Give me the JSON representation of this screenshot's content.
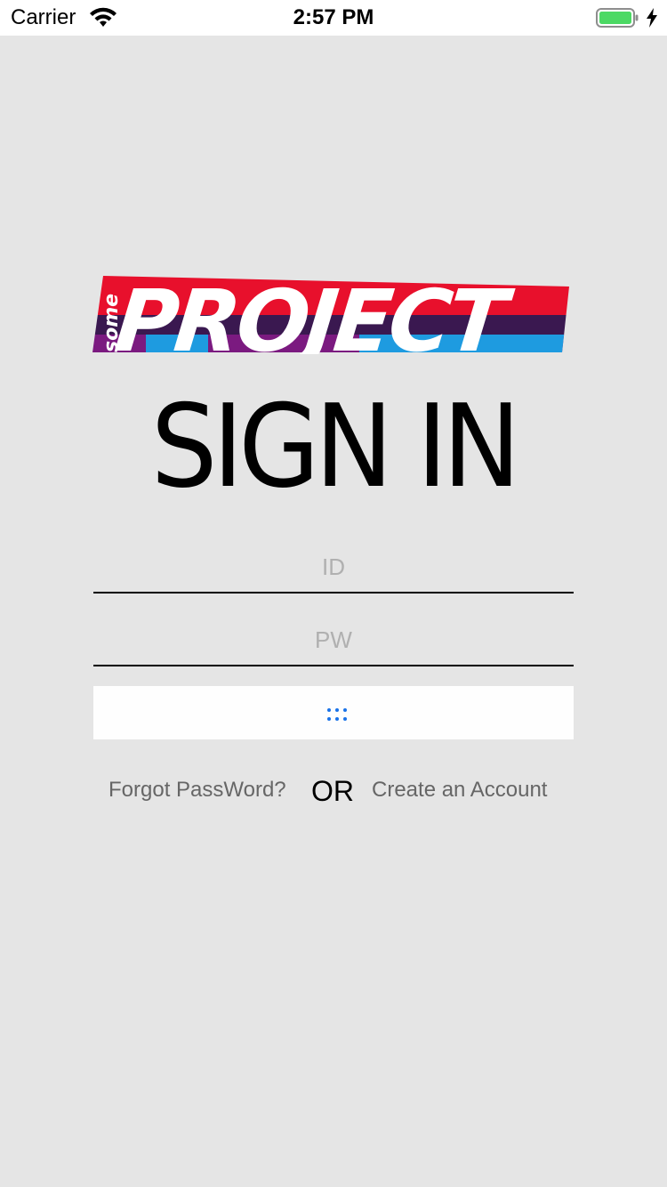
{
  "status_bar": {
    "carrier": "Carrier",
    "time": "2:57 PM",
    "battery_color": "#4cd964",
    "wifi_icon": "wifi-icon",
    "battery_icon": "battery-icon",
    "charging_icon": "charging-bolt-icon"
  },
  "logo": {
    "small_text": "some",
    "main_text": "PROJECT",
    "colors": {
      "red": "#e8102c",
      "dark": "#3a1850",
      "purple": "#7b1a80",
      "blue": "#1e9be0"
    }
  },
  "signin": {
    "title": "SIGN IN",
    "id_placeholder": "ID",
    "pw_placeholder": "PW",
    "submit_icon": "dots-grid-icon",
    "submit_icon_color": "#1a73e8"
  },
  "links": {
    "forgot": "Forgot PassWord?",
    "or": "OR",
    "create": "Create an Account"
  }
}
